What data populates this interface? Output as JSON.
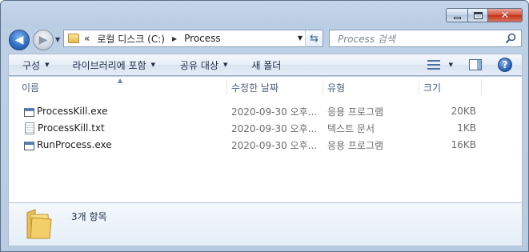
{
  "window": {
    "buttons": {
      "minimize": "minimize-icon",
      "maximize": "maximize-icon",
      "close": "close-icon"
    }
  },
  "nav": {
    "address": {
      "chevron": "«",
      "segments": [
        "로컬 디스크 (C:)",
        "Process"
      ]
    },
    "search_placeholder": "Process 검색"
  },
  "toolbar": {
    "organize": "구성",
    "include_in_library": "라이브러리에 포함",
    "share_with": "공유 대상",
    "new_folder": "새 폴더"
  },
  "columns": {
    "name": "이름",
    "date_modified": "수정한 날짜",
    "type": "유형",
    "size": "크기"
  },
  "files": [
    {
      "name": "ProcessKill.exe",
      "date": "2020-09-30 오후...",
      "type": "응용 프로그램",
      "size": "20KB",
      "icon": "exe"
    },
    {
      "name": "ProcessKill.txt",
      "date": "2020-09-30 오후...",
      "type": "텍스트 문서",
      "size": "1KB",
      "icon": "txt"
    },
    {
      "name": "RunProcess.exe",
      "date": "2020-09-30 오후...",
      "type": "응용 프로그램",
      "size": "16KB",
      "icon": "exe"
    }
  ],
  "details": {
    "item_count": "3개 항목"
  }
}
